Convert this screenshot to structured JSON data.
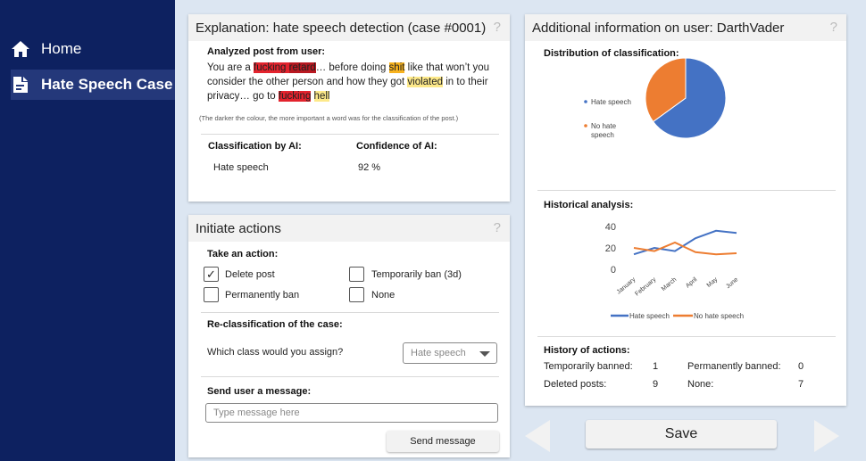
{
  "sidebar": {
    "items": [
      {
        "label": "Home",
        "icon": "home-icon"
      },
      {
        "label": "Hate Speech Case",
        "icon": "document-icon"
      }
    ]
  },
  "explanation": {
    "title": "Explanation: hate speech detection (case #0001)",
    "help": "?",
    "post_heading": "Analyzed post from user:",
    "post_segments": [
      {
        "t": "You are a ",
        "h": ""
      },
      {
        "t": "fucking ",
        "h": "red"
      },
      {
        "t": "retard",
        "h": "dark"
      },
      {
        "t": "… before doing ",
        "h": ""
      },
      {
        "t": "shit",
        "h": "orange"
      },
      {
        "t": " like that won’t you consider the other person and how they got ",
        "h": ""
      },
      {
        "t": "violated",
        "h": "yellow"
      },
      {
        "t": " in to their privacy… go to ",
        "h": ""
      },
      {
        "t": "fucking",
        "h": "red"
      },
      {
        "t": " ",
        "h": ""
      },
      {
        "t": "hell",
        "h": "yellow"
      }
    ],
    "note": "(The darker the colour, the more important a word was for the classification of the post.)",
    "classification_label": "Classification by AI:",
    "classification_value": "Hate speech",
    "confidence_label": "Confidence of AI:",
    "confidence_value": "92 %"
  },
  "actions": {
    "title": "Initiate actions",
    "help": "?",
    "take_action_label": "Take an action:",
    "options": [
      {
        "label": "Delete post",
        "checked": true
      },
      {
        "label": "Temporarily ban (3d)",
        "checked": false
      },
      {
        "label": "Permanently ban",
        "checked": false
      },
      {
        "label": "None",
        "checked": false
      }
    ],
    "reclass_label": "Re-classification of the case:",
    "reclass_question": "Which class would you assign?",
    "reclass_selected": "Hate speech",
    "message_label": "Send user a message:",
    "message_placeholder": "Type message here",
    "send_button": "Send message"
  },
  "user_info": {
    "title": "Additional information on user: DarthVader",
    "help": "?",
    "distribution_label": "Distribution of classification:",
    "history_label": "Historical analysis:",
    "actions_label": "History of actions:",
    "stats": [
      {
        "label": "Temporarily banned:",
        "value": "1"
      },
      {
        "label": "Permanently banned:",
        "value": "0"
      },
      {
        "label": "Deleted posts:",
        "value": "9"
      },
      {
        "label": "None:",
        "value": "7"
      }
    ]
  },
  "save_button": "Save",
  "colors": {
    "sidebar": "#0d2160",
    "hate": "#4472c4",
    "no_hate": "#ed7d31"
  },
  "chart_data": [
    {
      "type": "pie",
      "categories": [
        "Hate speech",
        "No hate speech"
      ],
      "values": [
        65,
        35
      ],
      "legend": "left"
    },
    {
      "type": "line",
      "categories": [
        "January",
        "February",
        "March",
        "April",
        "May",
        "June"
      ],
      "series": [
        {
          "name": "Hate speech",
          "values": [
            14,
            20,
            17,
            29,
            36,
            34
          ]
        },
        {
          "name": "No hate speech",
          "values": [
            20,
            17,
            25,
            16,
            14,
            15
          ]
        }
      ],
      "yticks": [
        0,
        20,
        40
      ],
      "ylim": [
        0,
        40
      ],
      "legend": "bottom"
    }
  ]
}
